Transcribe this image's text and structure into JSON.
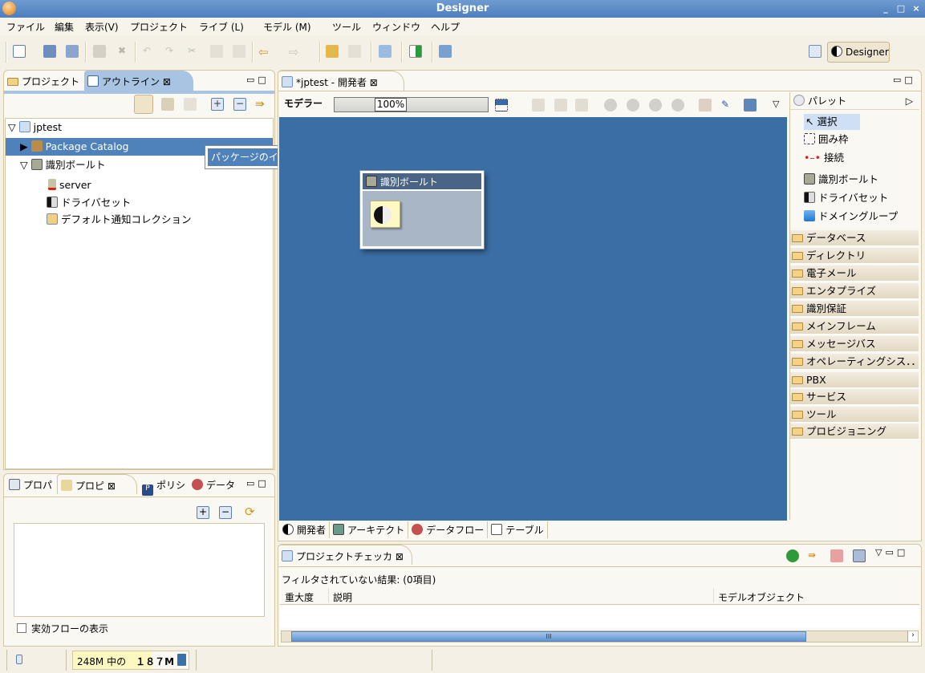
{
  "window": {
    "title": "Designer",
    "controls": [
      "_",
      "□",
      "×"
    ]
  },
  "menu": [
    "ファイル",
    "編集",
    "表示(V)",
    "プロジェクト",
    "ライブ (L)",
    "モデル (M)",
    "ツール",
    "ウィンドウ",
    "ヘルプ"
  ],
  "perspective": {
    "label": "Designer"
  },
  "left_top": {
    "tabs": [
      "プロジェクト",
      "アウトライン"
    ],
    "tree": [
      {
        "label": "jptest"
      },
      {
        "label": "Package Catalog"
      },
      {
        "label": "識別ボールト"
      },
      {
        "label": "server"
      },
      {
        "label": "ドライバセット"
      },
      {
        "label": "デフォルト通知コレクション"
      }
    ],
    "context_menu": {
      "item": "パッケージのインポート．．．"
    }
  },
  "left_bottom": {
    "tabs": [
      "プロパ",
      "プロピ",
      "ポリシ",
      "データ"
    ],
    "checkbox_label": "実効フローの表示",
    "checkbox_checked": false
  },
  "editor": {
    "tab": "*jptest - 開発者",
    "modeler_label": "モデラー",
    "zoom": "100%",
    "vault": {
      "title": "識別ボールト"
    },
    "bottom_tabs": [
      "開発者",
      "アーキテクト",
      "データフロー",
      "テーブル"
    ]
  },
  "palette": {
    "title": "パレット",
    "tools": [
      "選択",
      "囲み枠",
      "接続"
    ],
    "items": [
      "識別ボールト",
      "ドライバセット",
      "ドメイングループ"
    ],
    "drawers": [
      "データベース",
      "ディレクトリ",
      "電子メール",
      "エンタプライズ",
      "識別保証",
      "メインフレーム",
      "メッセージバス",
      "オペレーティングシス．．",
      "PBX",
      "サービス",
      "ツール",
      "プロビジョニング"
    ]
  },
  "checker": {
    "title": "プロジェクトチェッカ",
    "summary": "フィルタされていない結果: (0項目)",
    "columns": [
      "重大度",
      "説明",
      "モデルオブジェクト"
    ],
    "scroll_thumb": "III"
  },
  "status": {
    "memory_prefix": "248M 中の",
    "memory_used": "１８７M"
  }
}
